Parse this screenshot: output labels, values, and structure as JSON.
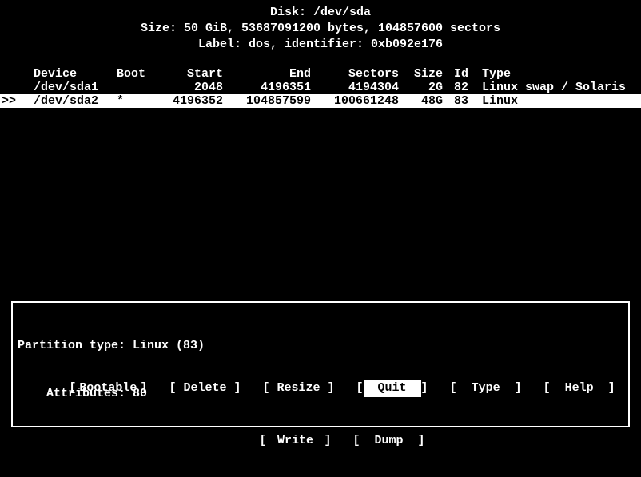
{
  "header": {
    "disk_prefix": "Disk: ",
    "disk_path": "/dev/sda",
    "size_line": "Size: 50 GiB, 53687091200 bytes, 104857600 sectors",
    "label_line": "Label: dos, identifier: 0xb092e176"
  },
  "columns": {
    "device": "Device",
    "boot": "Boot",
    "start": "Start",
    "end": "End",
    "sectors": "Sectors",
    "size": "Size",
    "id": "Id",
    "type": "Type"
  },
  "partitions": [
    {
      "selected": false,
      "marker": "",
      "device": "/dev/sda1",
      "boot": "",
      "start": "2048",
      "end": "4196351",
      "sectors": "4194304",
      "size": "2G",
      "id": "82",
      "type": "Linux swap / Solaris"
    },
    {
      "selected": true,
      "marker": ">>",
      "device": "/dev/sda2",
      "boot": "*",
      "start": "4196352",
      "end": "104857599",
      "sectors": "100661248",
      "size": "48G",
      "id": "83",
      "type": "Linux"
    }
  ],
  "info": {
    "partition_type_label": "Partition type:",
    "partition_type_value": "Linux (83)",
    "attributes_label": "    Attributes:",
    "attributes_value": "80"
  },
  "menu": {
    "row1": [
      {
        "label": "Bootable",
        "selected": false
      },
      {
        "label": "Delete",
        "selected": false
      },
      {
        "label": "Resize",
        "selected": false
      },
      {
        "label": "Quit",
        "selected": true
      },
      {
        "label": "Type",
        "selected": false
      },
      {
        "label": "Help",
        "selected": false
      }
    ],
    "row2": [
      {
        "label": "Write",
        "selected": false
      },
      {
        "label": "Dump",
        "selected": false
      }
    ]
  }
}
